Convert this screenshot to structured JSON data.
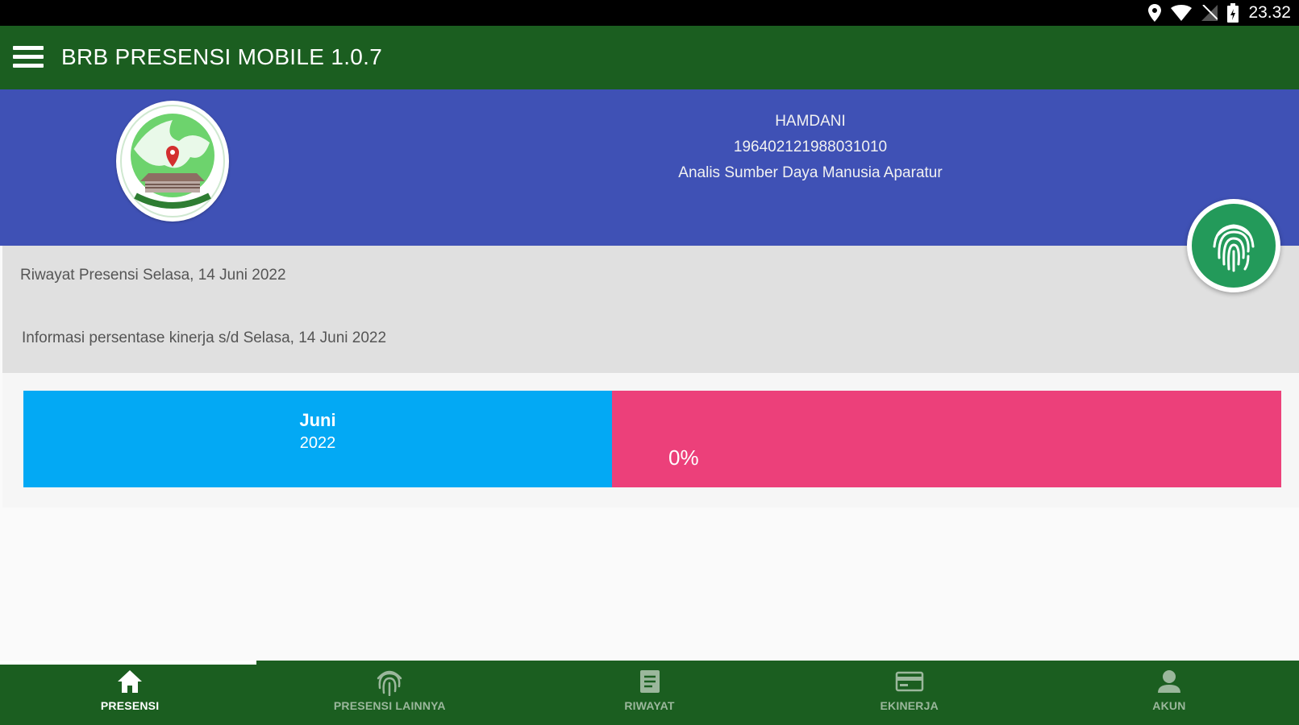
{
  "status_bar": {
    "time": "23.32",
    "icons": [
      "location-icon",
      "wifi-icon",
      "no-signal-icon",
      "battery-icon"
    ]
  },
  "app_bar": {
    "title": "BRB PRESENSI MOBILE 1.0.7",
    "menu_icon": "hamburger-menu-icon"
  },
  "profile": {
    "name": "HAMDANI",
    "nip": "196402121988031010",
    "position": "Analis Sumber Daya Manusia Aparatur"
  },
  "info": {
    "history": "Riwayat Presensi Selasa, 14 Juni 2022",
    "performance_info": "Informasi persentase kinerja s/d Selasa, 14 Juni 2022"
  },
  "kinerja": {
    "month": "Juni",
    "year": "2022",
    "percent": "0%"
  },
  "bottom_nav": {
    "items": [
      {
        "label": "PRESENSI",
        "icon": "home-icon",
        "active": true
      },
      {
        "label": "PRESENSI LAINNYA",
        "icon": "fingerprint-icon",
        "active": false
      },
      {
        "label": "RIWAYAT",
        "icon": "document-icon",
        "active": false
      },
      {
        "label": "EKINERJA",
        "icon": "card-icon",
        "active": false
      },
      {
        "label": "AKUN",
        "icon": "account-icon",
        "active": false
      }
    ]
  },
  "colors": {
    "app_bar": "#1b5e20",
    "header": "#3f51b5",
    "month_block": "#03a9f4",
    "percent_block": "#ec407a",
    "fab": "#239a5a"
  }
}
